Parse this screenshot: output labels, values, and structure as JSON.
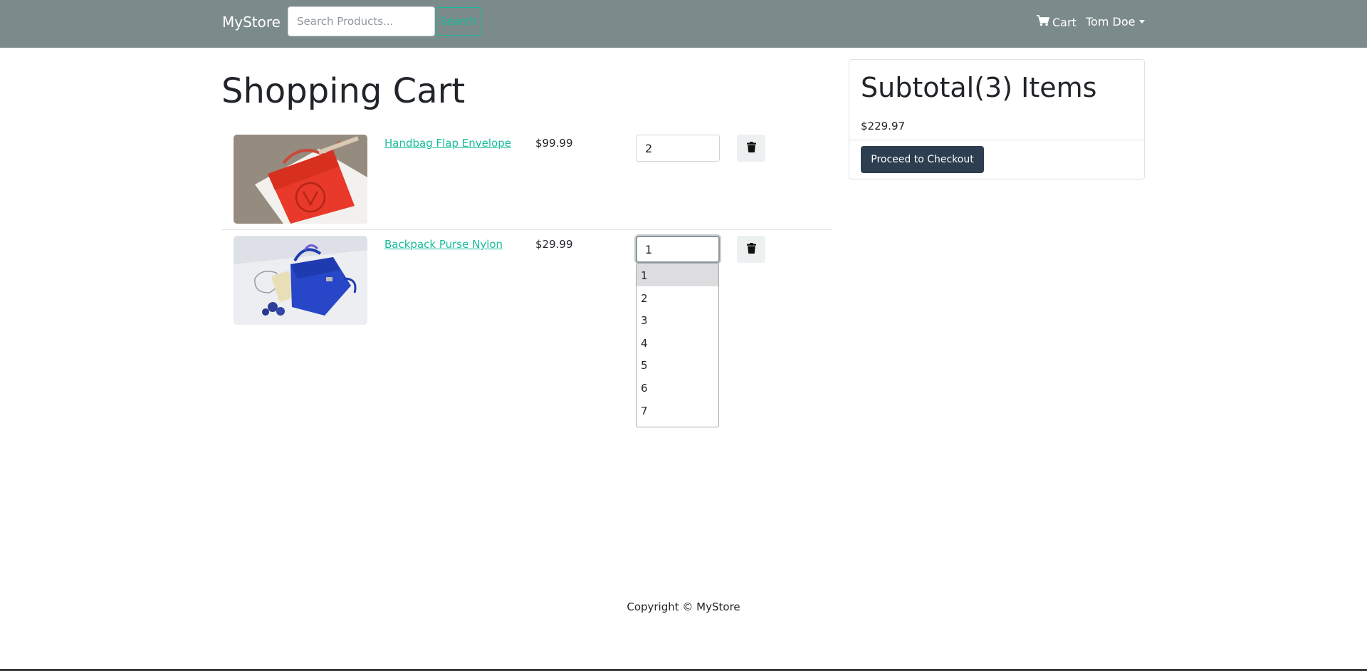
{
  "navbar": {
    "brand": "MyStore",
    "search_placeholder": "Search Products...",
    "search_label": "Search",
    "cart_label": "Cart",
    "cart_icon": "cart-icon",
    "user_name": "Tom Doe"
  },
  "cart": {
    "title": "Shopping Cart",
    "items": [
      {
        "name": "Handbag Flap Envelope",
        "price": "$99.99",
        "qty": "2",
        "image": "red-handbag-photo",
        "delete_icon": "trash-icon"
      },
      {
        "name": "Backpack Purse Nylon",
        "price": "$29.99",
        "qty": "1",
        "image": "blue-backpack-photo",
        "delete_icon": "trash-icon"
      }
    ],
    "qty_options": [
      "1",
      "2",
      "3",
      "4",
      "5",
      "6",
      "7"
    ],
    "open_dropdown_selected": "1"
  },
  "summary": {
    "title": "Subtotal(3) Items",
    "total": "$229.97",
    "checkout_label": "Proceed to Checkout"
  },
  "footer": {
    "copyright": "Copyright © MyStore"
  },
  "colors": {
    "navbar_bg": "#7b8a8b",
    "accent": "#18bc9c",
    "primary_dark": "#2c3e50"
  }
}
